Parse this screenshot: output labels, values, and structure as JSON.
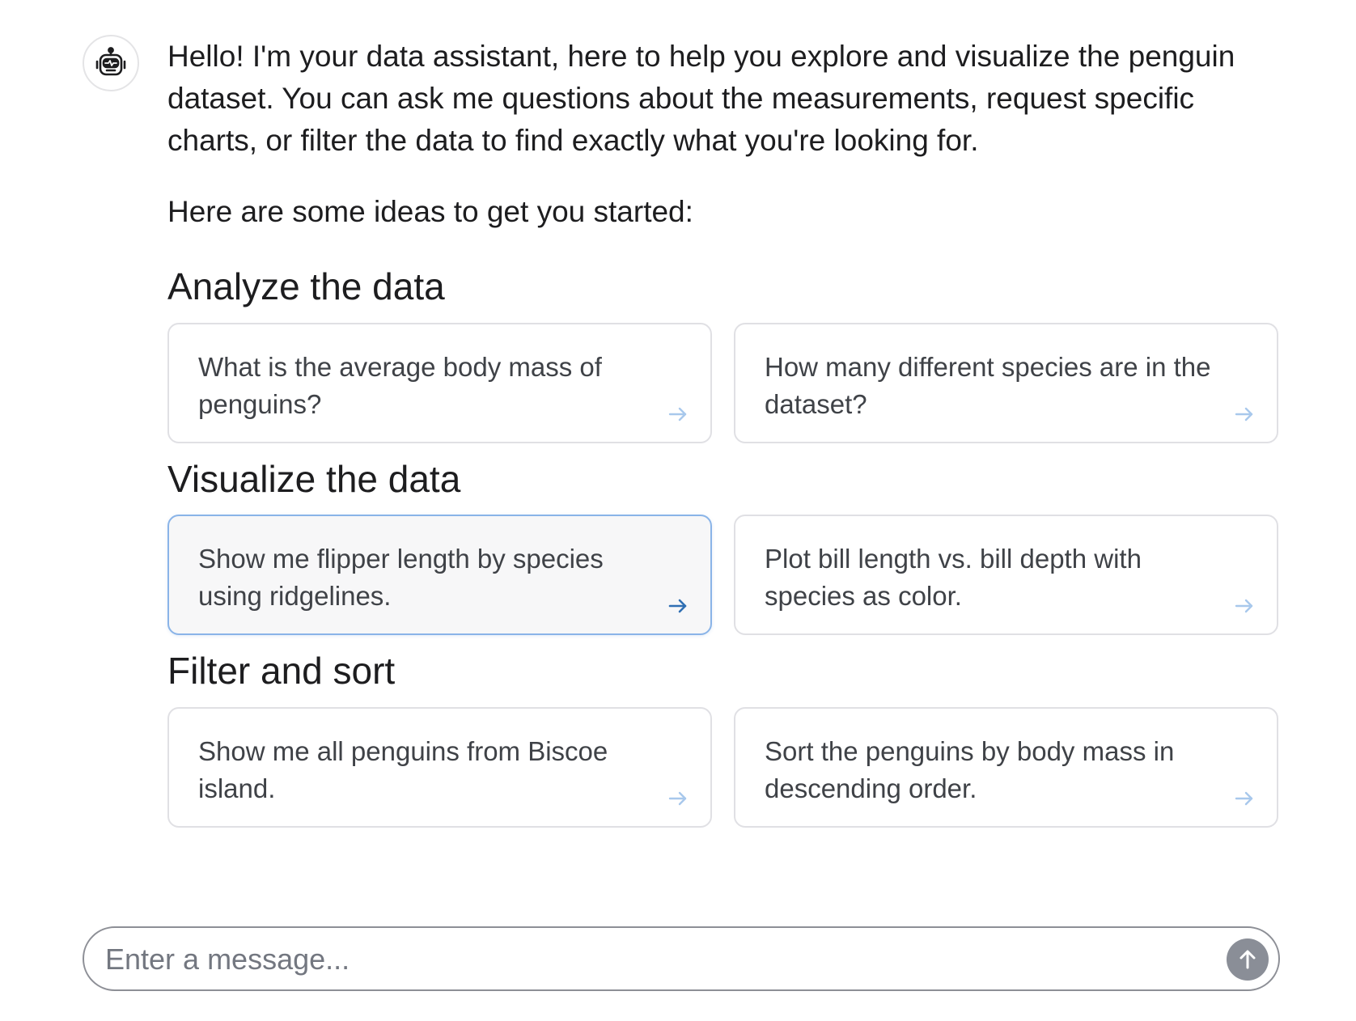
{
  "assistant": {
    "avatar_icon": "robot-icon",
    "intro": "Hello! I'm your data assistant, here to help you explore and visualize the penguin dataset. You can ask me questions about the measurements, request specific charts, or filter the data to find exactly what you're looking for.",
    "lead": "Here are some ideas to get you started:"
  },
  "sections": [
    {
      "title": "Analyze the data",
      "suggestions": [
        {
          "text": "What is the average body mass of penguins?"
        },
        {
          "text": "How many different species are in the dataset?"
        }
      ]
    },
    {
      "title": "Visualize the data",
      "suggestions": [
        {
          "text": "Show me flipper length by species using ridgelines."
        },
        {
          "text": "Plot bill length vs. bill depth with species as color."
        }
      ]
    },
    {
      "title": "Filter and sort",
      "suggestions": [
        {
          "text": "Show me all penguins from Biscoe island."
        },
        {
          "text": "Sort the penguins by body mass in descending order."
        }
      ]
    }
  ],
  "composer": {
    "placeholder": "Enter a message...",
    "send_icon": "arrow-up-icon"
  },
  "colors": {
    "arrow_idle": "#a8c8ec",
    "arrow_active": "#2f6fb3",
    "send_button": "#8a8e97"
  }
}
